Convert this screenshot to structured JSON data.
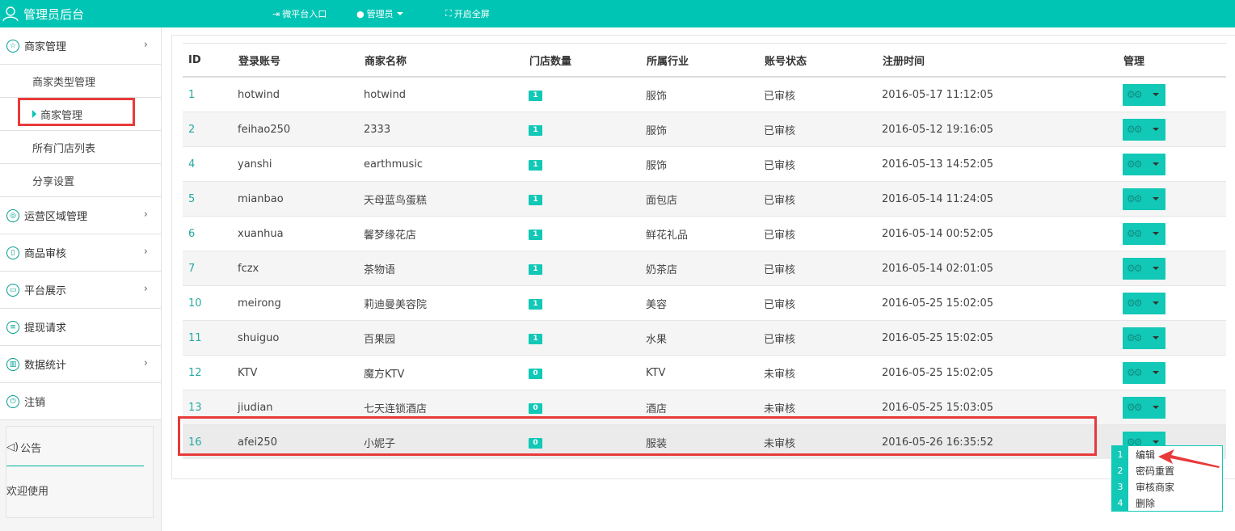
{
  "header": {
    "brand": "管理员后台",
    "nav": [
      {
        "label": "微平台入口",
        "icon": "enter-icon"
      },
      {
        "label": "管理员",
        "icon": "admin-user-icon"
      },
      {
        "label": "开启全屏",
        "icon": "fullscreen-icon"
      }
    ]
  },
  "sidebar": {
    "items": [
      {
        "label": "商家管理",
        "icon": "store-icon",
        "chevron": "›"
      },
      {
        "label": "运营区域管理",
        "icon": "location-icon",
        "chevron": "›"
      },
      {
        "label": "商品审核",
        "icon": "document-icon",
        "chevron": "›"
      },
      {
        "label": "平台展示",
        "icon": "display-icon",
        "chevron": "›"
      },
      {
        "label": "提现请求",
        "icon": "withdraw-icon"
      },
      {
        "label": "数据统计",
        "icon": "chart-icon",
        "chevron": "›"
      },
      {
        "label": "注销",
        "icon": "power-icon"
      }
    ],
    "subitems": [
      "商家类型管理",
      "商家管理",
      "所有门店列表",
      "分享设置"
    ],
    "notice": {
      "title": "公告",
      "body": "欢迎使用"
    }
  },
  "table": {
    "headers": [
      "ID",
      "登录账号",
      "商家名称",
      "门店数量",
      "所属行业",
      "账号状态",
      "注册时间",
      "管理"
    ],
    "rows": [
      {
        "id": "1",
        "account": "hotwind",
        "name": "hotwind",
        "stores": "1",
        "industry": "服饰",
        "status": "已审核",
        "time": "2016-05-17 11:12:05"
      },
      {
        "id": "2",
        "account": "feihao250",
        "name": "2333",
        "stores": "1",
        "industry": "服饰",
        "status": "已审核",
        "time": "2016-05-12 19:16:05"
      },
      {
        "id": "4",
        "account": "yanshi",
        "name": "earthmusic",
        "stores": "1",
        "industry": "服饰",
        "status": "已审核",
        "time": "2016-05-13 14:52:05"
      },
      {
        "id": "5",
        "account": "mianbao",
        "name": "天母蓝鸟蛋糕",
        "stores": "1",
        "industry": "面包店",
        "status": "已审核",
        "time": "2016-05-14 11:24:05"
      },
      {
        "id": "6",
        "account": "xuanhua",
        "name": "馨梦缘花店",
        "stores": "1",
        "industry": "鲜花礼品",
        "status": "已审核",
        "time": "2016-05-14 00:52:05"
      },
      {
        "id": "7",
        "account": "fczx",
        "name": "茶物语",
        "stores": "1",
        "industry": "奶茶店",
        "status": "已审核",
        "time": "2016-05-14 02:01:05"
      },
      {
        "id": "10",
        "account": "meirong",
        "name": "莉迪曼美容院",
        "stores": "1",
        "industry": "美容",
        "status": "已审核",
        "time": "2016-05-25 15:02:05"
      },
      {
        "id": "11",
        "account": "shuiguo",
        "name": "百果园",
        "stores": "1",
        "industry": "水果",
        "status": "已审核",
        "time": "2016-05-25 15:02:05"
      },
      {
        "id": "12",
        "account": "KTV",
        "name": "魔方KTV",
        "stores": "0",
        "industry": "KTV",
        "status": "未审核",
        "time": "2016-05-25 15:02:05"
      },
      {
        "id": "13",
        "account": "jiudian",
        "name": "七天连锁酒店",
        "stores": "0",
        "industry": "酒店",
        "status": "未审核",
        "time": "2016-05-25 15:03:05"
      },
      {
        "id": "16",
        "account": "afei250",
        "name": "小妮子",
        "stores": "0",
        "industry": "服装",
        "status": "未审核",
        "time": "2016-05-26 16:35:52"
      }
    ]
  },
  "dropdown": [
    {
      "num": "1",
      "label": "编辑"
    },
    {
      "num": "2",
      "label": "密码重置"
    },
    {
      "num": "3",
      "label": "审核商家"
    },
    {
      "num": "4",
      "label": "删除"
    }
  ],
  "colors": {
    "accent": "#00c4b4",
    "badge": "#12c8b6",
    "highlight": "#e83a3a"
  }
}
